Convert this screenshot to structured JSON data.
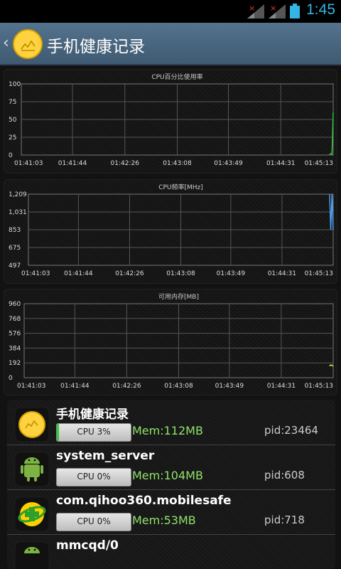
{
  "status_bar": {
    "time": "1:45"
  },
  "header": {
    "title": "手机健康记录",
    "back_icon": "chevron-left-icon",
    "app_icon": "health-chart-icon"
  },
  "charts": [
    {
      "title": "CPU百分比使用率",
      "type": "line",
      "y_ticks": [
        "100",
        "75",
        "50",
        "25",
        "0"
      ],
      "x_ticks": [
        "01:41:03",
        "01:41:44",
        "01:42:26",
        "01:43:08",
        "01:43:49",
        "01:44:31",
        "01:45:13"
      ],
      "ylim": [
        0,
        100
      ],
      "series": [
        {
          "color": "#2ecc40",
          "points": [
            {
              "x": "01:45:10",
              "y": 1
            },
            {
              "x": "01:45:11",
              "y": 2
            },
            {
              "x": "01:45:12",
              "y": 1
            },
            {
              "x": "01:45:13",
              "y": 60
            }
          ]
        }
      ]
    },
    {
      "title": "CPU频率[MHz]",
      "type": "line",
      "y_ticks": [
        "1,209",
        "1,031",
        "853",
        "675",
        "497"
      ],
      "x_ticks": [
        "01:41:03",
        "01:41:44",
        "01:42:26",
        "01:43:08",
        "01:43:49",
        "01:44:31",
        "01:45:13"
      ],
      "ylim": [
        497,
        1209
      ],
      "series": [
        {
          "color": "#4da6ff",
          "points": [
            {
              "x": "01:45:10",
              "y": 1209
            },
            {
              "x": "01:45:11",
              "y": 853
            },
            {
              "x": "01:45:12",
              "y": 1209
            },
            {
              "x": "01:45:13",
              "y": 853
            }
          ]
        }
      ]
    },
    {
      "title": "可用内存[MB]",
      "type": "line",
      "y_ticks": [
        "960",
        "768",
        "576",
        "384",
        "192",
        "0"
      ],
      "x_ticks": [
        "01:41:03",
        "01:41:44",
        "01:42:26",
        "01:43:08",
        "01:43:49",
        "01:44:31",
        "01:45:13"
      ],
      "ylim": [
        0,
        960
      ],
      "series": [
        {
          "color": "#ffeb3b",
          "points": [
            {
              "x": "01:45:10",
              "y": 150
            },
            {
              "x": "01:45:11",
              "y": 165
            },
            {
              "x": "01:45:12",
              "y": 160
            },
            {
              "x": "01:45:13",
              "y": 150
            }
          ]
        }
      ]
    }
  ],
  "processes": [
    {
      "name": "手机健康记录",
      "cpu": "CPU 3%",
      "cpu_percent": 3,
      "mem": "Mem:112MB",
      "pid": "pid:23464",
      "icon": "health-chart-icon"
    },
    {
      "name": "system_server",
      "cpu": "CPU 0%",
      "cpu_percent": 0,
      "mem": "Mem:104MB",
      "pid": "pid:608",
      "icon": "android-icon"
    },
    {
      "name": "com.qihoo360.mobilesafe",
      "cpu": "CPU 0%",
      "cpu_percent": 0,
      "mem": "Mem:53MB",
      "pid": "pid:718",
      "icon": "qihoo-shield-icon"
    },
    {
      "name": "mmcqd/0",
      "cpu": "",
      "cpu_percent": 0,
      "mem": "",
      "pid": "",
      "icon": "android-icon"
    }
  ]
}
